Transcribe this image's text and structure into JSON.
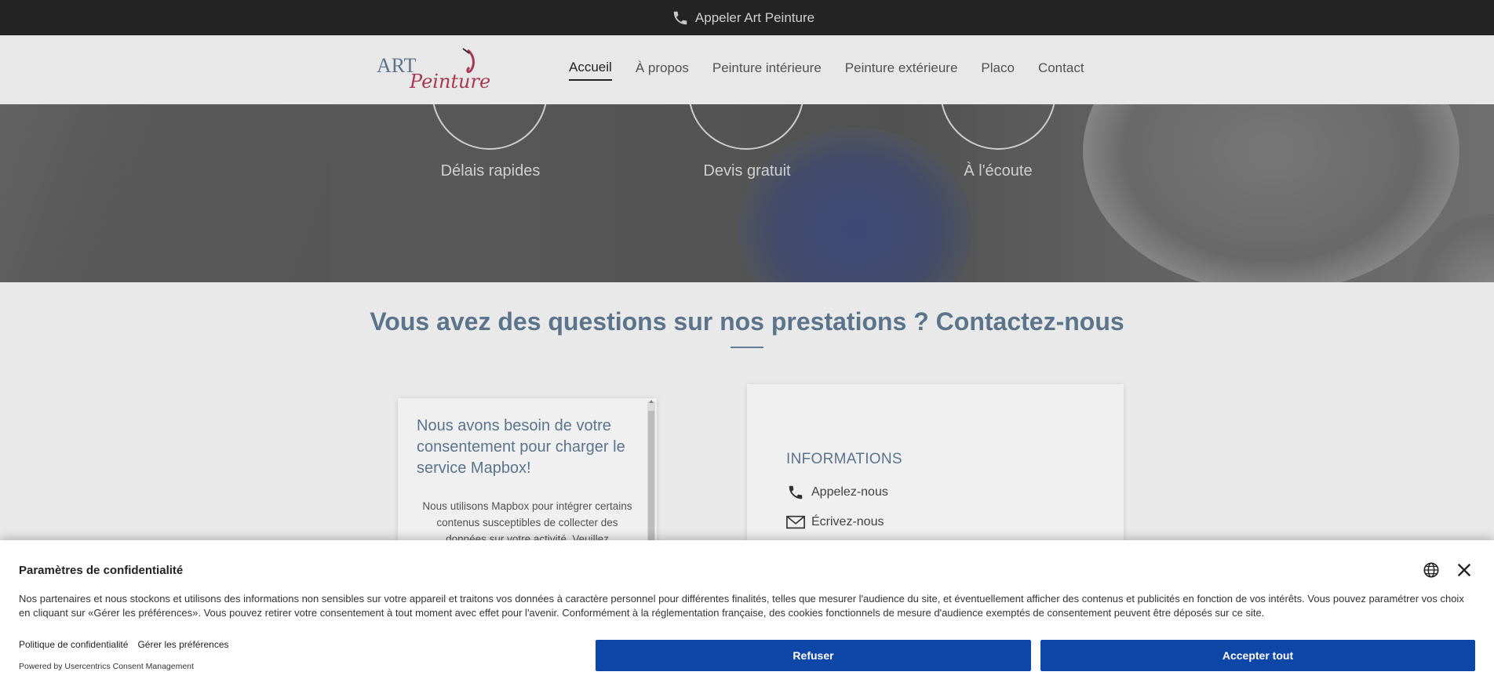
{
  "topbar": {
    "call_label": "Appeler Art Peinture",
    "icon": "phone-icon"
  },
  "header": {
    "logo": {
      "line1": "ART",
      "line2": "Peinture"
    },
    "nav": [
      {
        "label": "Accueil",
        "active": true
      },
      {
        "label": "À propos",
        "active": false
      },
      {
        "label": "Peinture intérieure",
        "active": false
      },
      {
        "label": "Peinture extérieure",
        "active": false
      },
      {
        "label": "Placo",
        "active": false
      },
      {
        "label": "Contact",
        "active": false
      }
    ]
  },
  "hero": {
    "features": [
      {
        "label": "Délais rapides"
      },
      {
        "label": "Devis gratuit"
      },
      {
        "label": "À  l'écoute"
      }
    ]
  },
  "contact_section": {
    "title": "Vous avez des questions sur nos prestations ? Contactez-nous",
    "map_consent": {
      "heading": "Nous avons besoin de votre consentement pour charger le service Mapbox!",
      "body": "Nous utilisons Mapbox pour intégrer certains contenus susceptibles de collecter des données sur votre activité. Veuillez"
    },
    "info": {
      "title": "INFORMATIONS",
      "call": "Appelez-nous",
      "write": "Écrivez-nous"
    }
  },
  "consent_banner": {
    "title": "Paramètres de confidentialité",
    "text": "Nos partenaires et nous stockons et utilisons des informations non sensibles sur votre appareil et traitons vos données à caractère personnel pour différentes finalités, telles que mesurer l'audience du site, et éventuellement afficher des contenus et publicités en fonction de vos intérêts. Vous pouvez paramétrer vos choix en cliquant sur «Gérer les préférences». Vous pouvez retirer votre consentement à tout moment avec effet pour l'avenir. Conformément à la réglementation française, des cookies fonctionnels de mesure d'audience exemptés de consentement peuvent être déposés sur ce site.",
    "privacy_link": "Politique de confidentialité",
    "manage_link": "Gérer les préférences",
    "powered_by": "Powered by Usercentrics Consent Management",
    "refuse_label": "Refuser",
    "accept_label": "Accepter tout",
    "button_color": "#0f47a8"
  }
}
